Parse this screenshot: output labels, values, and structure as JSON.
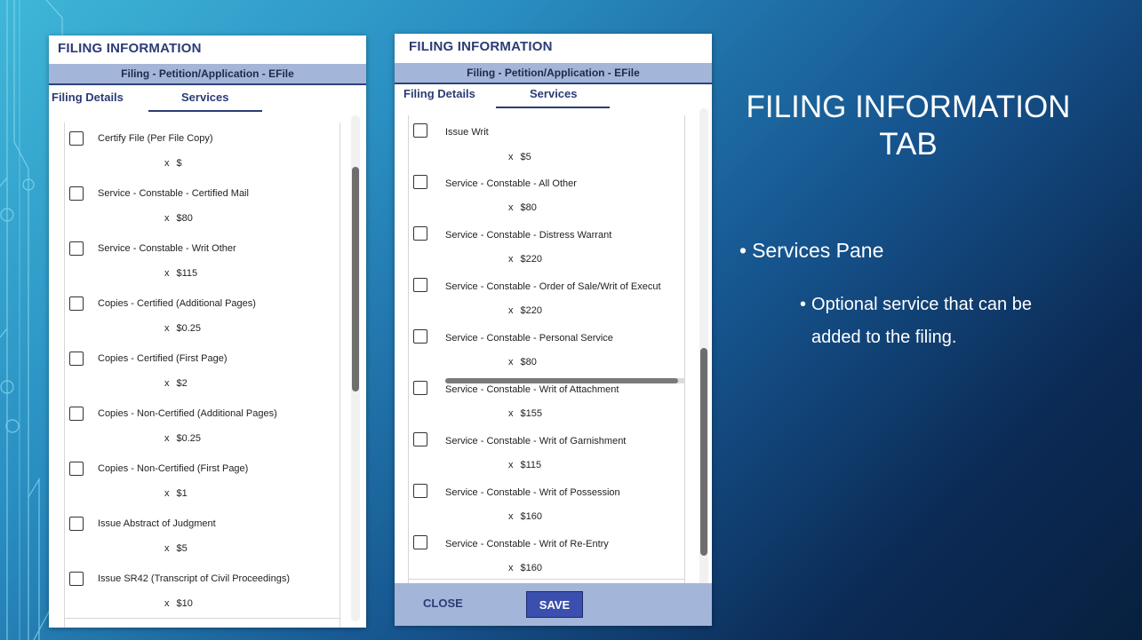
{
  "slide": {
    "title": "FILING INFORMATION TAB",
    "bullet_level1": "Services Pane",
    "bullet_level2": "Optional service that can be added to the filing."
  },
  "left_panel": {
    "title": "FILING INFORMATION",
    "subheader": "Filing - Petition/Application - EFile",
    "tabs": [
      {
        "label": "Filing Details",
        "active": false
      },
      {
        "label": "Services",
        "active": true
      }
    ],
    "services": [
      {
        "name": "Certify File (Per File Copy)",
        "qty_mark": "x",
        "price": "$"
      },
      {
        "name": "Service - Constable - Certified Mail",
        "qty_mark": "x",
        "price": "$80"
      },
      {
        "name": "Service - Constable - Writ Other",
        "qty_mark": "x",
        "price": "$115"
      },
      {
        "name": "Copies - Certified (Additional Pages)",
        "qty_mark": "x",
        "price": "$0.25"
      },
      {
        "name": "Copies - Certified (First Page)",
        "qty_mark": "x",
        "price": "$2"
      },
      {
        "name": "Copies - Non-Certified (Additional Pages)",
        "qty_mark": "x",
        "price": "$0.25"
      },
      {
        "name": "Copies - Non-Certified (First Page)",
        "qty_mark": "x",
        "price": "$1"
      },
      {
        "name": "Issue Abstract of Judgment",
        "qty_mark": "x",
        "price": "$5"
      },
      {
        "name": "Issue SR42 (Transcript of Civil Proceedings)",
        "qty_mark": "x",
        "price": "$10"
      }
    ]
  },
  "right_panel": {
    "title": "FILING INFORMATION",
    "subheader": "Filing - Petition/Application - EFile",
    "tabs": [
      {
        "label": "Filing Details",
        "active": false
      },
      {
        "label": "Services",
        "active": true
      }
    ],
    "services": [
      {
        "name": "Issue Writ",
        "qty_mark": "x",
        "price": "$5"
      },
      {
        "name": "Service - Constable - All Other",
        "qty_mark": "x",
        "price": "$80"
      },
      {
        "name": "Service - Constable - Distress Warrant",
        "qty_mark": "x",
        "price": "$220"
      },
      {
        "name": "Service - Constable - Order of Sale/Writ of Execut",
        "qty_mark": "x",
        "price": "$220"
      },
      {
        "name": "Service - Constable - Personal Service",
        "qty_mark": "x",
        "price": "$80"
      },
      {
        "name": "Service - Constable - Writ of Attachment",
        "qty_mark": "x",
        "price": "$155"
      },
      {
        "name": "Service - Constable - Writ of Garnishment",
        "qty_mark": "x",
        "price": "$115"
      },
      {
        "name": "Service - Constable - Writ of Possession",
        "qty_mark": "x",
        "price": "$160"
      },
      {
        "name": "Service - Constable - Writ of Re-Entry",
        "qty_mark": "x",
        "price": "$160"
      }
    ],
    "footer": {
      "close_label": "CLOSE",
      "save_label": "SAVE"
    }
  },
  "colors": {
    "header_text": "#2b3b75",
    "subheader_bg": "#a3b5d8",
    "save_button": "#3a4fae"
  }
}
